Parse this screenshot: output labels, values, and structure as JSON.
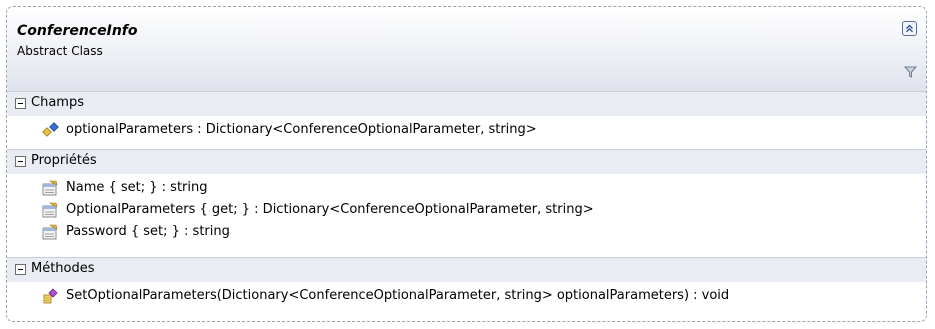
{
  "class": {
    "name": "ConferenceInfo",
    "stereotype": "Abstract Class"
  },
  "compartments": {
    "fields": {
      "title": "Champs",
      "items": [
        {
          "icon": "field-icon",
          "text": "optionalParameters : Dictionary<ConferenceOptionalParameter, string>"
        }
      ]
    },
    "properties": {
      "title": "Propriétés",
      "items": [
        {
          "icon": "property-icon",
          "text": "Name { set; } : string"
        },
        {
          "icon": "property-icon",
          "text": "OptionalParameters { get; } : Dictionary<ConferenceOptionalParameter, string>"
        },
        {
          "icon": "property-icon",
          "text": "Password { set; } : string"
        }
      ]
    },
    "methods": {
      "title": "Méthodes",
      "items": [
        {
          "icon": "method-icon",
          "text": "SetOptionalParameters(Dictionary<ConferenceOptionalParameter, string> optionalParameters) : void"
        }
      ]
    }
  }
}
